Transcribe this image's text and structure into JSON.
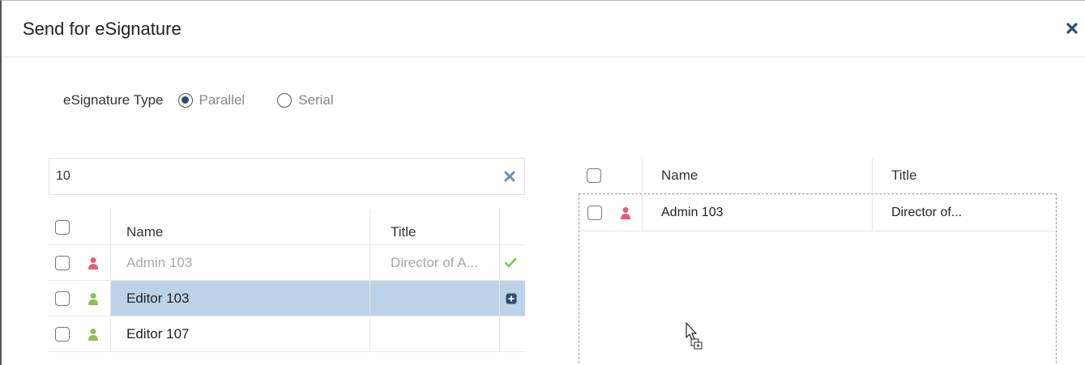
{
  "dialog": {
    "title": "Send for eSignature",
    "close_icon": "close-x-icon"
  },
  "esignature_type": {
    "label": "eSignature Type",
    "options": [
      {
        "label": "Parallel",
        "selected": true
      },
      {
        "label": "Serial",
        "selected": false
      }
    ]
  },
  "search": {
    "value": "10",
    "clear_icon": "clear-x-icon"
  },
  "left_table": {
    "columns": {
      "name": "Name",
      "title": "Title"
    },
    "rows": [
      {
        "name": "Admin 103",
        "title": "Director of A...",
        "icon": "user-icon",
        "icon_color": "#e0607a",
        "state": "added",
        "status_icon": "checkmark-icon"
      },
      {
        "name": "Editor 103",
        "title": "",
        "icon": "user-icon",
        "icon_color": "#8cc04f",
        "state": "selected",
        "status_icon": "plus-square-icon"
      },
      {
        "name": "Editor 107",
        "title": "",
        "icon": "user-icon",
        "icon_color": "#8cc04f",
        "state": "normal",
        "status_icon": ""
      }
    ]
  },
  "right_table": {
    "columns": {
      "name": "Name",
      "title": "Title"
    },
    "rows": [
      {
        "name": "Admin 103",
        "title": "Director of...",
        "icon": "user-icon",
        "icon_color": "#e0607a"
      }
    ]
  },
  "colors": {
    "accent": "#2b4a78",
    "selected_row": "#bcd2e6",
    "check_green": "#8cc04f",
    "admin_red": "#e0607a",
    "editor_green": "#8cc04f"
  },
  "cursor": "drag-copy-cursor-icon"
}
